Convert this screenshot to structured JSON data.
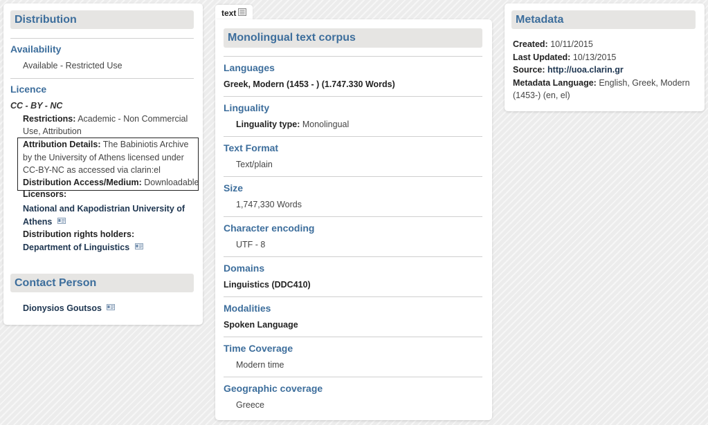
{
  "left": {
    "distribution_header": "Distribution",
    "availability_title": "Availability",
    "availability_value": "Available - Restricted Use",
    "licence_title": "Licence",
    "licence_name": "CC - BY - NC",
    "restrictions_label": "Restrictions:",
    "restrictions_value": "Academic - Non Commercial Use, Attribution",
    "attribution_label": "Attribution Details:",
    "attribution_value": "The Babiniotis Archive by the University of Athens licensed under CC-BY-NC as accessed via clarin:el",
    "access_label": "Distribution Access/Medium:",
    "access_value": "Downloadable",
    "licensors_label": "Licensors:",
    "licensor_name": "National and Kapodistrian University of Athens",
    "rights_holders_label": "Distribution rights holders:",
    "rights_holder_name": "Department of Linguistics",
    "contact_header": "Contact Person",
    "contact_name": "Dionysios Goutsos"
  },
  "middle": {
    "tab_label": "text",
    "header": "Monolingual text corpus",
    "languages_title": "Languages",
    "languages_value": "Greek, Modern (1453 - ) (1.747.330 Words)",
    "linguality_title": "Linguality",
    "linguality_label": "Linguality type:",
    "linguality_value": "Monolingual",
    "text_format_title": "Text Format",
    "text_format_value": "Text/plain",
    "size_title": "Size",
    "size_value": "1,747,330 Words",
    "encoding_title": "Character encoding",
    "encoding_value": "UTF - 8",
    "domains_title": "Domains",
    "domains_value": "Linguistics (DDC410)",
    "modalities_title": "Modalities",
    "modalities_value": "Spoken Language",
    "time_title": "Time Coverage",
    "time_value": "Modern time",
    "geo_title": "Geographic coverage",
    "geo_value": "Greece"
  },
  "right": {
    "header": "Metadata",
    "created_label": "Created:",
    "created_value": "10/11/2015",
    "updated_label": "Last Updated:",
    "updated_value": "10/13/2015",
    "source_label": "Source:",
    "source_value": "http://uoa.clarin.gr",
    "metadata_lang_label": "Metadata Language:",
    "metadata_lang_value": "English, Greek, Modern (1453-) (en, el)"
  },
  "icons": {
    "contact_card": "contact-card-icon",
    "text_tab": "text-document-icon"
  }
}
